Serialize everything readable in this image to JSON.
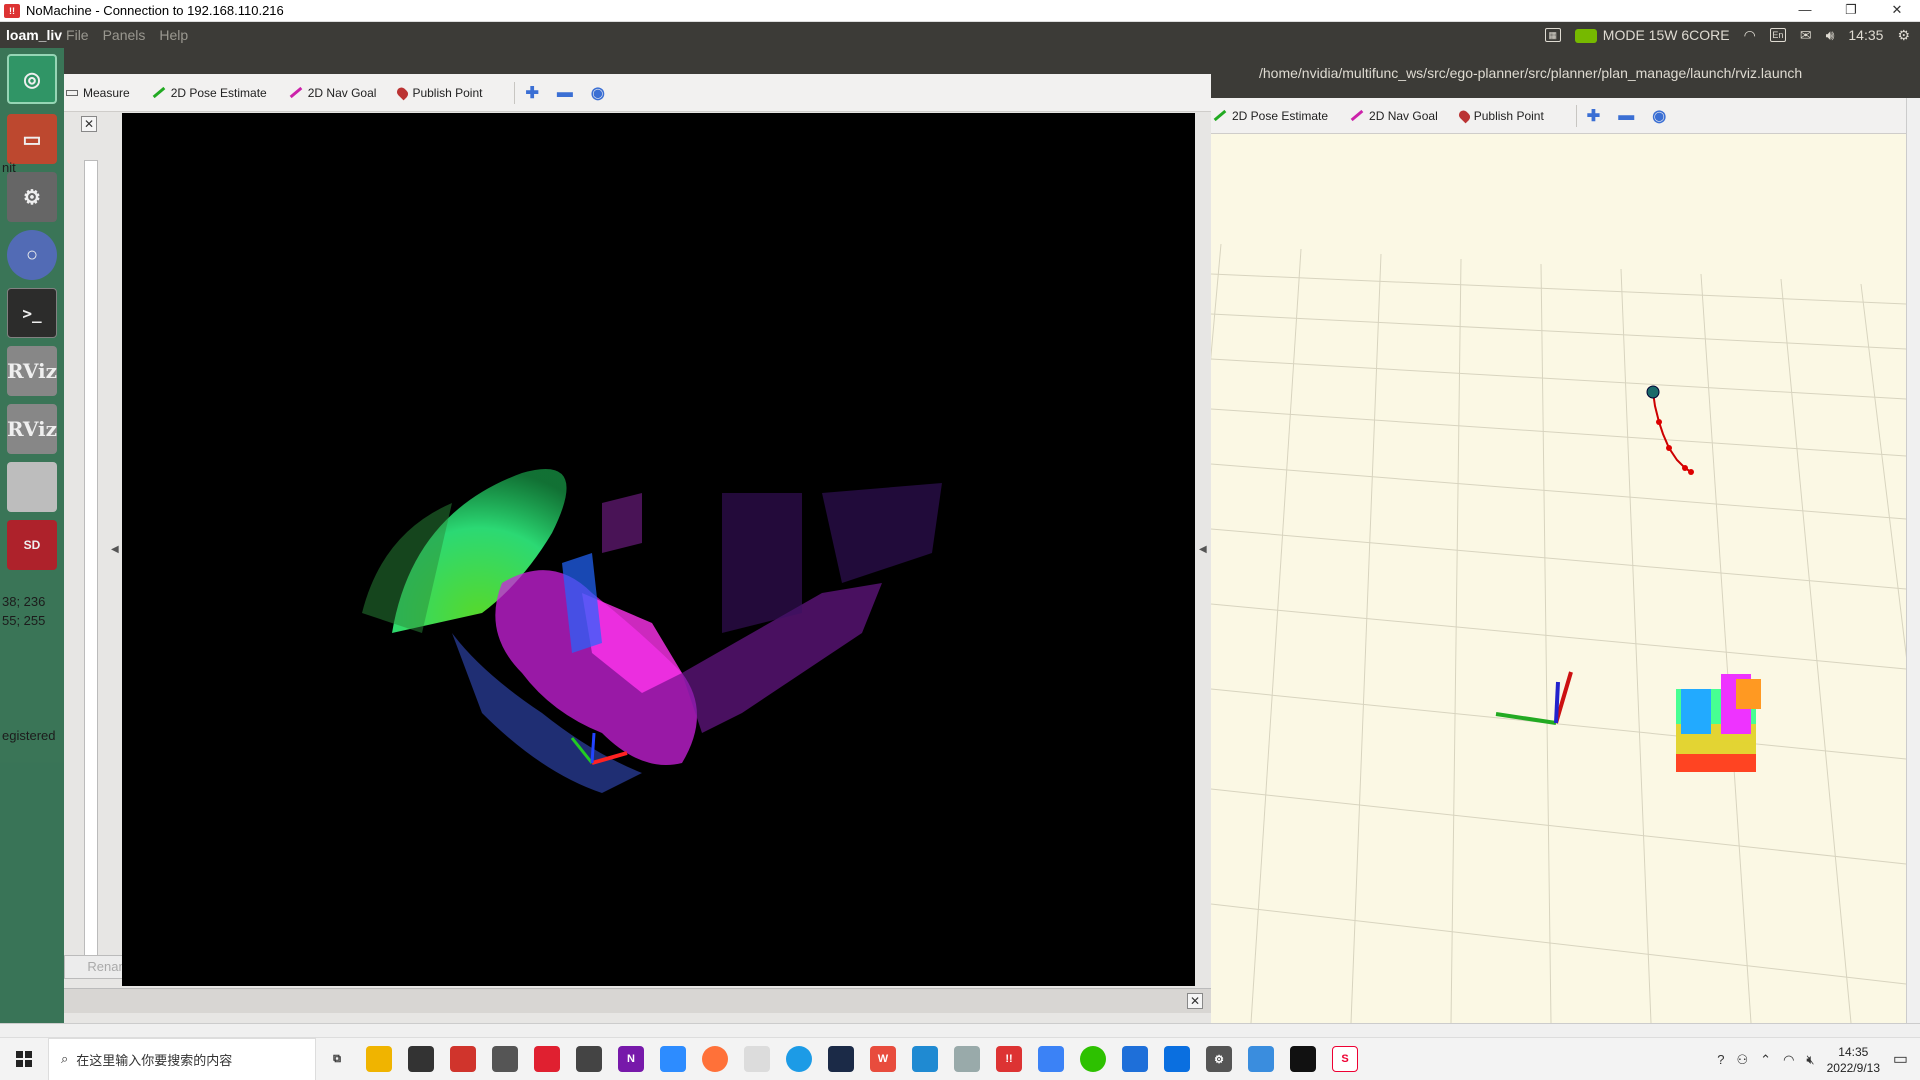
{
  "window": {
    "title": "NoMachine - Connection to 192.168.110.216",
    "controls": [
      "—",
      "❐",
      "✕"
    ]
  },
  "ubuntu_panel": {
    "app_name": "loam_liv",
    "menus": [
      "File",
      "Panels",
      "Help"
    ],
    "mode_text": "MODE 15W 6CORE",
    "keyboard": "En",
    "time": "14:35"
  },
  "launcher": {
    "items": [
      "ubuntu-dash",
      "files",
      "system-settings",
      "chromium",
      "terminal",
      "rviz",
      "rviz",
      "drive",
      "sd-card"
    ],
    "sd_label": "SD",
    "rviz_label": "RViz",
    "terminal_label": ">_",
    "partial_texts": [
      "nit",
      "38; 236",
      "55; 255",
      "egistered"
    ]
  },
  "left_rviz": {
    "toolbar": {
      "measure": "Measure",
      "pose_estimate": "2D Pose Estimate",
      "nav_goal": "2D Nav Goal",
      "publish_point": "Publish Point"
    },
    "rename_button": "Rename"
  },
  "right_rviz": {
    "title_path": "/home/nvidia/multifunc_ws/src/ego-planner/src/planner/plan_manage/launch/rviz.launch",
    "toolbar": {
      "pose_estimate": "2D Pose Estimate",
      "nav_goal": "2D Nav Goal",
      "publish_point": "Publish Point"
    }
  },
  "taskbar": {
    "search_placeholder": "在这里输入你要搜索的内容",
    "clock_time": "14:35",
    "clock_date": "2022/9/13",
    "app_icons": [
      "task-view",
      "file-explorer",
      "store",
      "app-red-diamond",
      "mail",
      "app-red",
      "camera",
      "onenote",
      "zoom",
      "firefox",
      "paint",
      "edge",
      "powershell",
      "wps",
      "vscode",
      "app-gray",
      "nomachine",
      "app-blue",
      "wechat",
      "app-cloud",
      "app-phone",
      "settings",
      "app-monitor",
      "terminal",
      "app-sogou"
    ]
  },
  "colors": {
    "ubuntu_panel": "#3c3b37",
    "launcher": "#3a7a5a",
    "rviz_viewport_right": "#fbf8e4",
    "pose_green": "#22aa22",
    "nav_magenta": "#cc22aa"
  }
}
